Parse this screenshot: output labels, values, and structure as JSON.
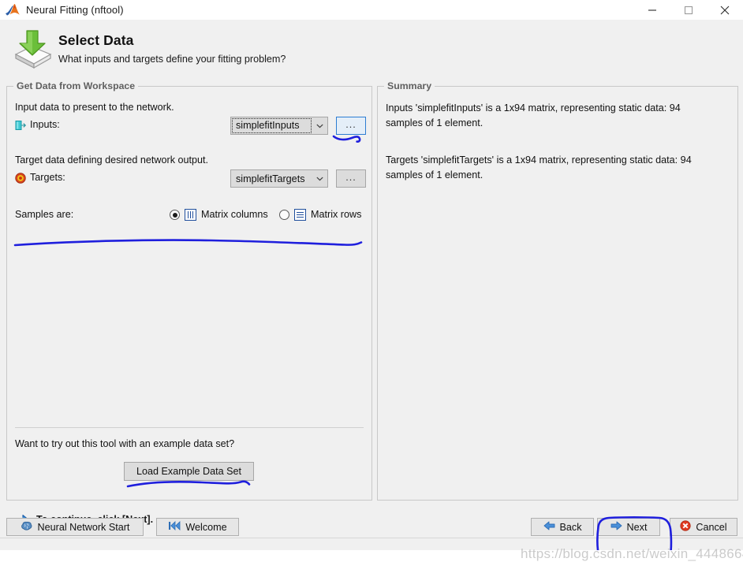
{
  "window": {
    "title": "Neural Fitting (nftool)",
    "logo_icon": "matlab-membrane-icon",
    "minimize_label": "—",
    "maximize_label": "□",
    "close_label": "✕"
  },
  "header": {
    "icon": "import-data-arrow-icon",
    "title": "Select Data",
    "subtitle": "What inputs and targets define your fitting problem?"
  },
  "left_panel": {
    "legend": "Get Data from Workspace",
    "input_description": "Input data to present to the network.",
    "inputs_label": "Inputs:",
    "inputs_icon": "input-port-icon",
    "inputs_value": "simplefitInputs",
    "inputs_browse_label": "...",
    "target_description": "Target data defining desired network output.",
    "targets_label": "Targets:",
    "targets_icon": "target-bullseye-icon",
    "targets_value": "simplefitTargets",
    "targets_browse_label": "...",
    "samples_label": "Samples are:",
    "samples_options": [
      {
        "label": "Matrix columns",
        "icon": "matrix-columns-icon",
        "selected": true
      },
      {
        "label": "Matrix rows",
        "icon": "matrix-rows-icon",
        "selected": false
      }
    ],
    "example_question": "Want to try out this tool with an example data set?",
    "example_button": "Load Example Data Set"
  },
  "right_panel": {
    "legend": "Summary",
    "inputs_summary": "Inputs 'simplefitInputs' is a 1x94 matrix, representing static data: 94 samples of 1 element.",
    "targets_summary": "Targets 'simplefitTargets' is a 1x94 matrix, representing static data: 94 samples of 1 element."
  },
  "footer": {
    "hint_icon": "blue-right-arrow-icon",
    "hint": "To continue, click [Next].",
    "neural_network_start": "Neural Network Start",
    "neural_network_start_icon": "brain-icon",
    "welcome": "Welcome",
    "welcome_icon": "skip-to-start-icon",
    "back": "Back",
    "back_icon": "arrow-left-icon",
    "next": "Next",
    "next_icon": "arrow-right-icon",
    "cancel": "Cancel",
    "cancel_icon": "error-circle-icon"
  },
  "watermark": "https://blog.csdn.net/weixin_44486647",
  "annotations": {
    "color": "#1f1fdd",
    "marks": [
      "underline-under-inputs-browse",
      "underline-under-samples-row",
      "underline-under-load-example-button",
      "circle-around-next-button"
    ]
  },
  "colors": {
    "window_bg": "#f0f0f0",
    "panel_border": "#c8c8c8",
    "legend_text": "#606060",
    "control_face": "#dcdcdc",
    "focus_blue": "#2d7dd2",
    "annotation_blue": "#1f1fdd"
  }
}
